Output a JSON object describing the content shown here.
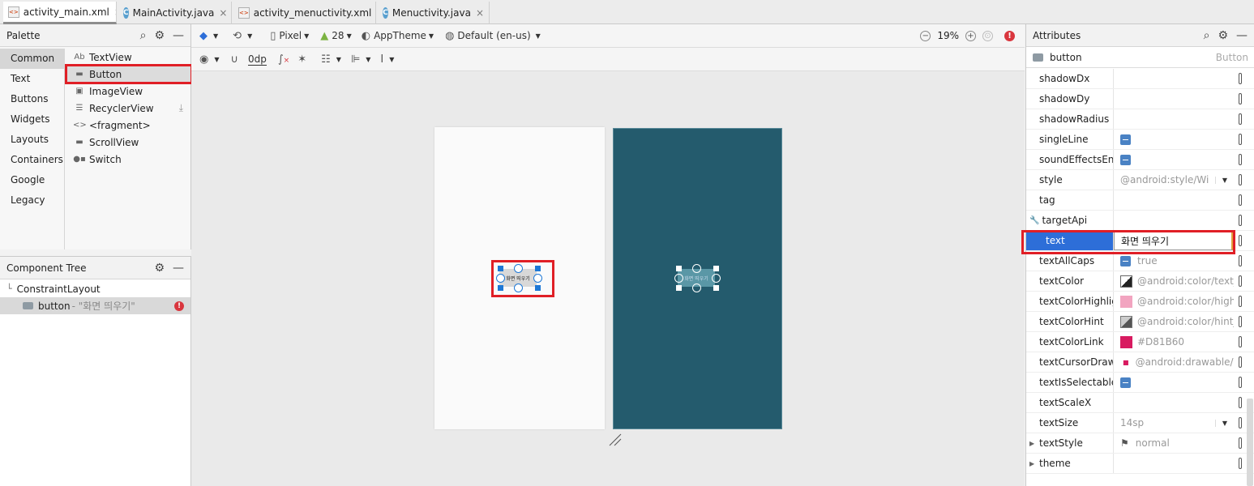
{
  "tabs": [
    {
      "label": "activity_main.xml",
      "type": "xml",
      "active": true
    },
    {
      "label": "MainActivity.java",
      "type": "java",
      "active": false
    },
    {
      "label": "activity_menuctivity.xml",
      "type": "xml",
      "active": false
    },
    {
      "label": "Menuctivity.java",
      "type": "java",
      "active": false
    }
  ],
  "palette": {
    "title": "Palette",
    "categories": [
      "Common",
      "Text",
      "Buttons",
      "Widgets",
      "Layouts",
      "Containers",
      "Google",
      "Legacy"
    ],
    "items": [
      "TextView",
      "Button",
      "ImageView",
      "RecyclerView",
      "<fragment>",
      "ScrollView",
      "Switch"
    ]
  },
  "component_tree": {
    "title": "Component Tree",
    "root": "ConstraintLayout",
    "child_id": "button",
    "child_text": "- \"화면 띄우기\""
  },
  "toolbar": {
    "device": "Pixel",
    "api": "28",
    "theme": "AppTheme",
    "locale": "Default (en-us)",
    "zoom": "19%",
    "margin": "0dp"
  },
  "canvas": {
    "button_text": "화면 띄우기"
  },
  "attributes": {
    "title": "Attributes",
    "selected_id": "button",
    "selected_type": "Button",
    "rows": [
      {
        "name": "shadowDx",
        "value": ""
      },
      {
        "name": "shadowDy",
        "value": ""
      },
      {
        "name": "shadowRadius",
        "value": ""
      },
      {
        "name": "singleLine",
        "value": ""
      },
      {
        "name": "soundEffectsEnabl",
        "value": ""
      },
      {
        "name": "style",
        "value": "@android:style/Wi"
      },
      {
        "name": "tag",
        "value": ""
      },
      {
        "name": "targetApi",
        "value": ""
      },
      {
        "name": "text",
        "value": "화면 띄우기"
      },
      {
        "name": "textAllCaps",
        "value": "true"
      },
      {
        "name": "textColor",
        "value": "@android:color/text_"
      },
      {
        "name": "textColorHighlight",
        "value": "@android:color/highl"
      },
      {
        "name": "textColorHint",
        "value": "@android:color/hint_"
      },
      {
        "name": "textColorLink",
        "value": "#D81B60"
      },
      {
        "name": "textCursorDrawab",
        "value": "@android:drawable/t"
      },
      {
        "name": "textIsSelectable",
        "value": ""
      },
      {
        "name": "textScaleX",
        "value": ""
      },
      {
        "name": "textSize",
        "value": "14sp"
      },
      {
        "name": "textStyle",
        "value": "normal"
      },
      {
        "name": "theme",
        "value": ""
      }
    ]
  },
  "colors": {
    "accent": "#2d6ed8",
    "highlight_red": "#e01f26",
    "blueprint": "#245b6d",
    "textColorLink": "#D81B60",
    "textColorHighlight": "#f2a4c0"
  }
}
